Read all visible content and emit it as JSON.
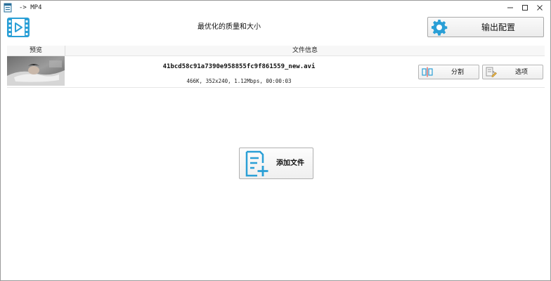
{
  "window": {
    "title": "-> MP4",
    "minimize_glyph": "—",
    "maximize_glyph": "☐",
    "close_glyph": "✕"
  },
  "header": {
    "quality_label": "最优化的质量和大小",
    "output_config_label": "输出配置"
  },
  "table": {
    "columns": [
      "预览",
      "文件信息"
    ],
    "rows": [
      {
        "file_name": "41bcd58c91a7390e958855fc9f861559_new.avi",
        "meta": "466K, 352x240, 1.12Mbps, 00:00:03",
        "split_label": "分割",
        "options_label": "选项"
      }
    ]
  },
  "main": {
    "add_file_label": "添加文件"
  },
  "colors": {
    "accent_blue": "#2a9fd6",
    "split_red": "#d9534f"
  },
  "icons": {
    "app": "app-icon",
    "video": "video-file-icon",
    "gear": "gear-icon",
    "split": "split-icon",
    "options": "options-icon",
    "add_file": "add-file-icon"
  }
}
